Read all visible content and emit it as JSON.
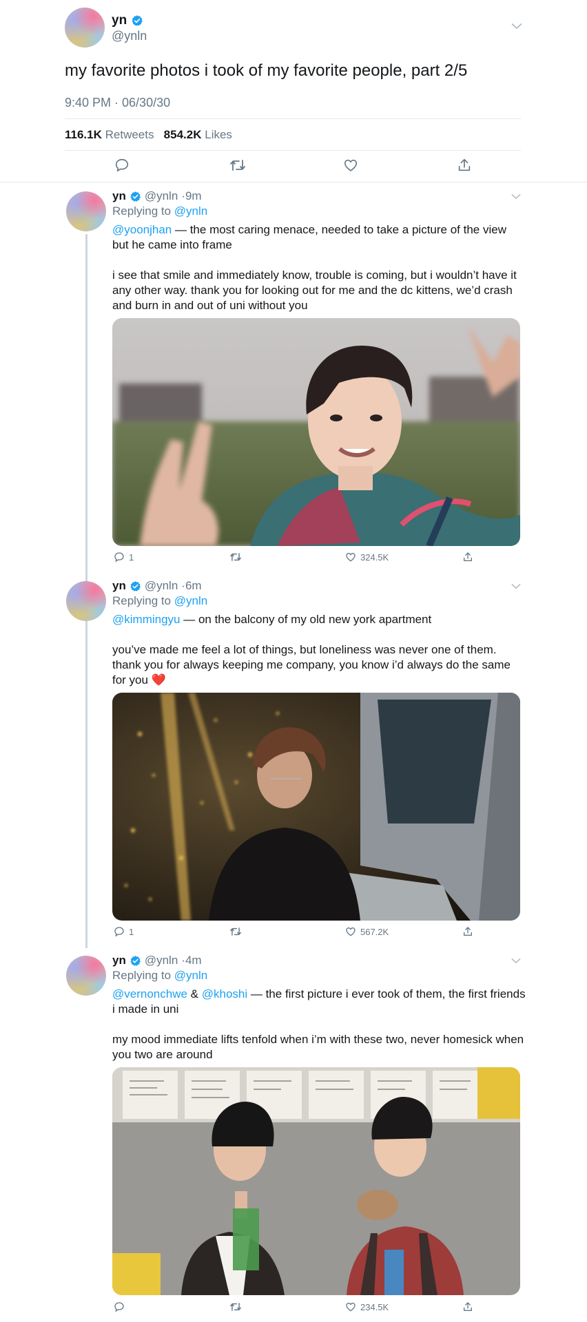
{
  "main": {
    "name": "yn",
    "handle": "@ynln",
    "text": "my favorite photos i took of my favorite people, part 2/5",
    "timestamp": "9:40 PM · 06/30/30",
    "retweets_count": "116.1K",
    "retweets_label": "Retweets",
    "likes_count": "854.2K",
    "likes_label": "Likes"
  },
  "replies": [
    {
      "name": "yn",
      "handle": "@ynln",
      "time": "·9m",
      "replying_prefix": "Replying to",
      "replying_to": "@ynln",
      "mention": "@yoonjhan",
      "text1": " — the most caring menace, needed to take a picture of the view but he came into frame",
      "text2": "i see that smile and immediately know, trouble is coming, but i wouldn’t have it any other way. thank you for looking out for me and the dc kittens, we’d crash and burn in and out of uni without you",
      "reply_count": "1",
      "like_count": "324.5K"
    },
    {
      "name": "yn",
      "handle": "@ynln",
      "time": "·6m",
      "replying_prefix": "Replying to",
      "replying_to": "@ynln",
      "mention": "@kimmingyu",
      "text1": " — on the balcony of my old new york apartment",
      "text2": "you’ve made me feel a lot of things, but loneliness was never one of them. thank you for always keeping me company, you know i’d always do the same for you",
      "emoji": "❤️",
      "reply_count": "1",
      "like_count": "567.2K"
    },
    {
      "name": "yn",
      "handle": "@ynln",
      "time": "·4m",
      "replying_prefix": "Replying to",
      "replying_to": "@ynln",
      "mention": "@vernonchwe",
      "amp": " & ",
      "mention2": "@khoshi",
      "text1": " — the first picture i ever took of them, the first friends i made in uni",
      "text2": "my mood immediate lifts tenfold when i’m with these two, never homesick when you two are around",
      "like_count": "234.5K"
    }
  ],
  "icons": {
    "verified": "verified-badge-icon",
    "reply": "reply-icon",
    "retweet": "retweet-icon",
    "like": "heart-icon",
    "share": "share-icon",
    "more": "chevron-down-icon"
  },
  "colors": {
    "accent": "#1da1f2",
    "secondary_text": "#657786",
    "divider": "#e1e8ed",
    "emoji_heart": "#e0245e"
  }
}
